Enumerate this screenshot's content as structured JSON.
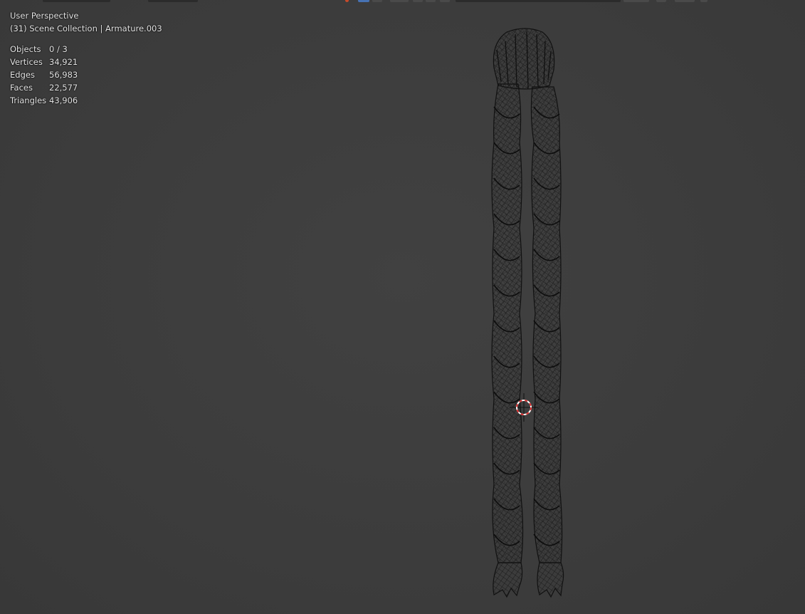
{
  "viewport": {
    "view_name": "User Perspective",
    "collection_info": "(31) Scene Collection | Armature.003"
  },
  "stats": [
    {
      "label": "Objects",
      "value": "0 / 3"
    },
    {
      "label": "Vertices",
      "value": "34,921"
    },
    {
      "label": "Edges",
      "value": "56,983"
    },
    {
      "label": "Faces",
      "value": "22,577"
    },
    {
      "label": "Triangles",
      "value": "43,906"
    }
  ],
  "colors": {
    "background": "#3d3d3d",
    "wire": "#111111",
    "cursor_red": "#e03030",
    "cursor_white": "#ffffff"
  },
  "icons": {
    "cursor": "3d-cursor-icon"
  }
}
